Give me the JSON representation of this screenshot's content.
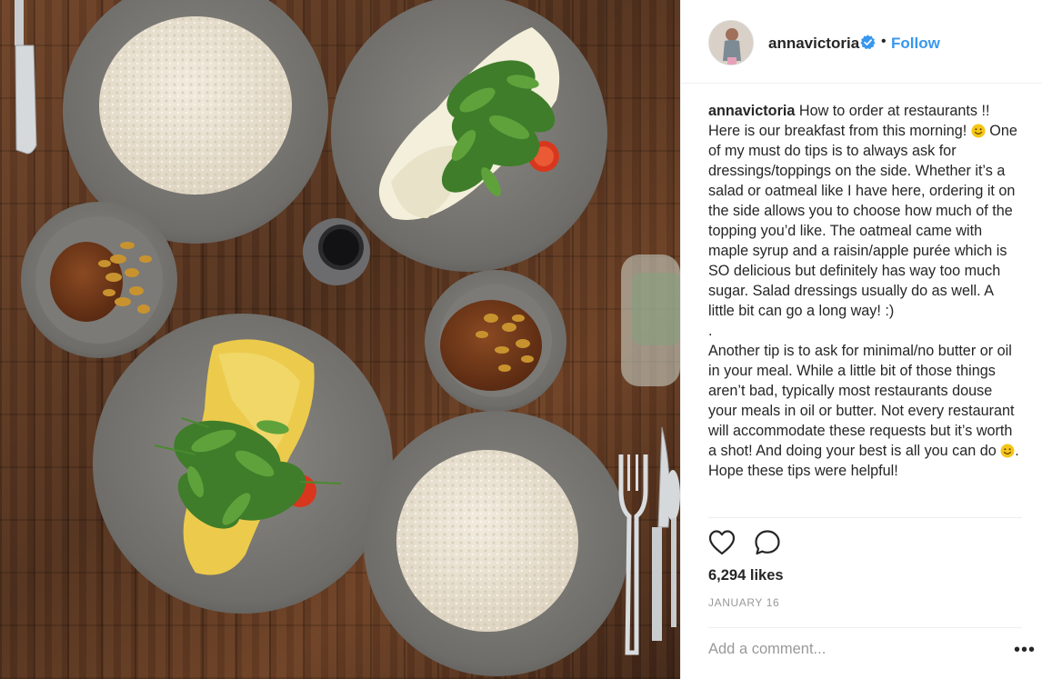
{
  "post": {
    "username": "annavictoria",
    "separator": "•",
    "follow_label": "Follow",
    "caption": {
      "line1": "How to order at restaurants !! Here is our breakfast from this morning!",
      "line2": "One of my must do tips is to always ask for dressings/toppings on the side. Whether it’s a salad or oatmeal like I have here, ordering it on the side allows you to choose how much of the topping you’d like. The oatmeal came with maple syrup and a raisin/apple purée which is SO delicious but definitely has way too much sugar. Salad dressings usually do as well. A little bit can go a long way! :)",
      "dot_line": ".",
      "para2a": "Another tip is to ask for minimal/no butter or oil in your meal. While a little bit of those things aren’t bad, typically most restaurants douse your meals in oil or butter. Not every restaurant will accommodate these requests but it’s worth a shot! And doing your best is all you can do",
      "para2b": ". Hope these tips were helpful!"
    },
    "likes": "6,294 likes",
    "date": "JANUARY 16",
    "comment_placeholder": "Add a comment...",
    "more_label": "•••"
  },
  "icons": {
    "verified": "verified-badge-icon",
    "like": "heart-icon",
    "comment": "comment-bubble-icon",
    "emoji": "smiley-emoji-icon"
  },
  "colors": {
    "link_blue": "#3897f0",
    "text": "#262626",
    "muted": "#999999",
    "divider": "#efefef",
    "emoji_yellow": "#f5c518"
  }
}
